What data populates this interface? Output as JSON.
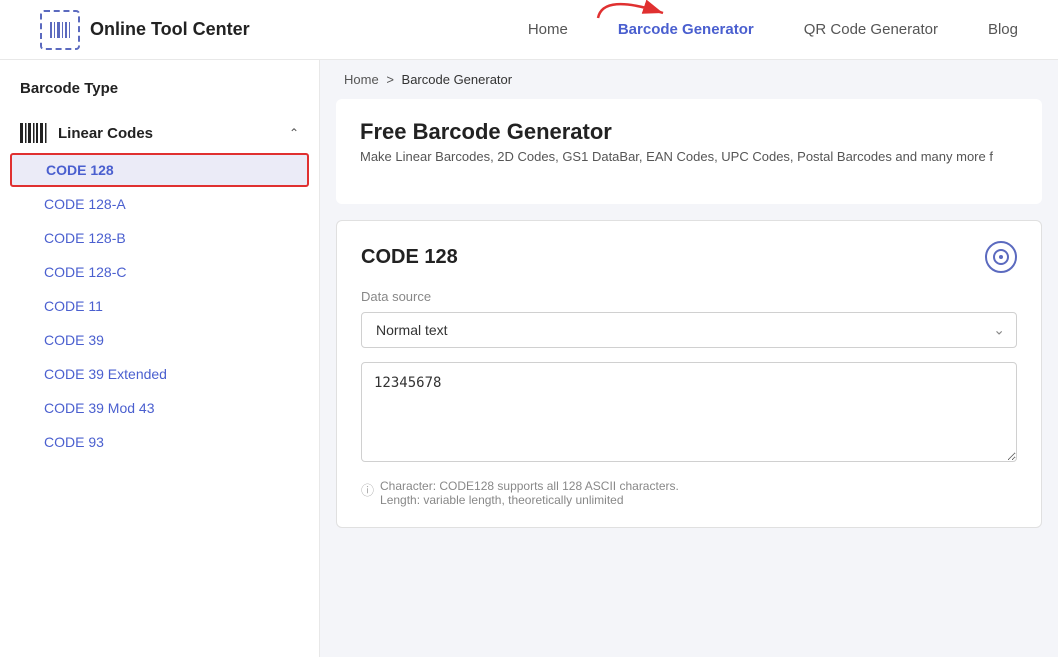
{
  "header": {
    "logo_text": "Online Tool Center",
    "nav": [
      {
        "label": "Home",
        "active": false
      },
      {
        "label": "Barcode Generator",
        "active": true
      },
      {
        "label": "QR Code Generator",
        "active": false
      },
      {
        "label": "Blog",
        "active": false
      }
    ]
  },
  "sidebar": {
    "title": "Barcode Type",
    "linear_codes_label": "Linear Codes",
    "items": [
      {
        "label": "CODE 128",
        "selected": true
      },
      {
        "label": "CODE 128-A",
        "selected": false
      },
      {
        "label": "CODE 128-B",
        "selected": false
      },
      {
        "label": "CODE 128-C",
        "selected": false
      },
      {
        "label": "CODE 11",
        "selected": false
      },
      {
        "label": "CODE 39",
        "selected": false
      },
      {
        "label": "CODE 39 Extended",
        "selected": false
      },
      {
        "label": "CODE 39 Mod 43",
        "selected": false
      },
      {
        "label": "CODE 93",
        "selected": false
      }
    ]
  },
  "breadcrumb": {
    "home": "Home",
    "separator": ">",
    "current": "Barcode Generator"
  },
  "main": {
    "page_title": "Free Barcode Generator",
    "page_subtitle": "Make Linear Barcodes, 2D Codes, GS1 DataBar, EAN Codes, UPC Codes, Postal Barcodes and many more f",
    "code128": {
      "title": "CODE 128",
      "data_source_label": "Data source",
      "dropdown_value": "Normal text",
      "textarea_value": "12345678",
      "info_text_line1": "Character: CODE128 supports all 128 ASCII characters.",
      "info_text_line2": "Length: variable length, theoretically unlimited"
    }
  }
}
